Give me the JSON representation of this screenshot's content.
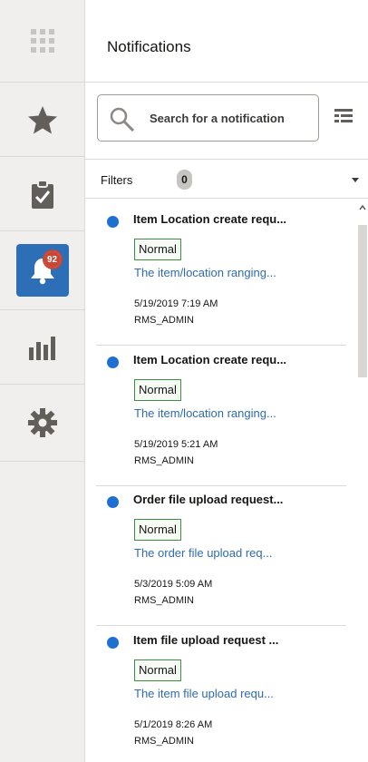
{
  "nav": {
    "items": [
      {
        "name": "apps-grid-icon"
      },
      {
        "name": "favorites-star-icon"
      },
      {
        "name": "tasks-clipboard-icon"
      },
      {
        "name": "notifications-bell-icon",
        "badge": "92",
        "active": true
      },
      {
        "name": "reports-bar-chart-icon"
      },
      {
        "name": "settings-gear-icon"
      }
    ],
    "notification_count": "92"
  },
  "panel": {
    "title": "Notifications",
    "search_placeholder": "Search for a notification",
    "filters_label": "Filters",
    "filters_count": "0"
  },
  "notifications": [
    {
      "title": "Item Location create requ...",
      "priority": "Normal",
      "description": "The item/location ranging...",
      "date": "5/19/2019 7:19 AM",
      "user": "RMS_ADMIN"
    },
    {
      "title": "Item Location create requ...",
      "priority": "Normal",
      "description": "The item/location ranging...",
      "date": "5/19/2019 5:21 AM",
      "user": "RMS_ADMIN"
    },
    {
      "title": "Order file upload request...",
      "priority": "Normal",
      "description": "The order file upload req...",
      "date": "5/3/2019 5:09 AM",
      "user": "RMS_ADMIN"
    },
    {
      "title": "Item file upload request ...",
      "priority": "Normal",
      "description": "The item file upload requ...",
      "date": "5/1/2019 8:26 AM",
      "user": "RMS_ADMIN"
    }
  ],
  "colors": {
    "accent": "#2c6fb7",
    "unread_dot": "#1e6fd2",
    "badge": "#c74634",
    "priority_border": "#3c8f3e",
    "link": "#2f6bb0"
  }
}
